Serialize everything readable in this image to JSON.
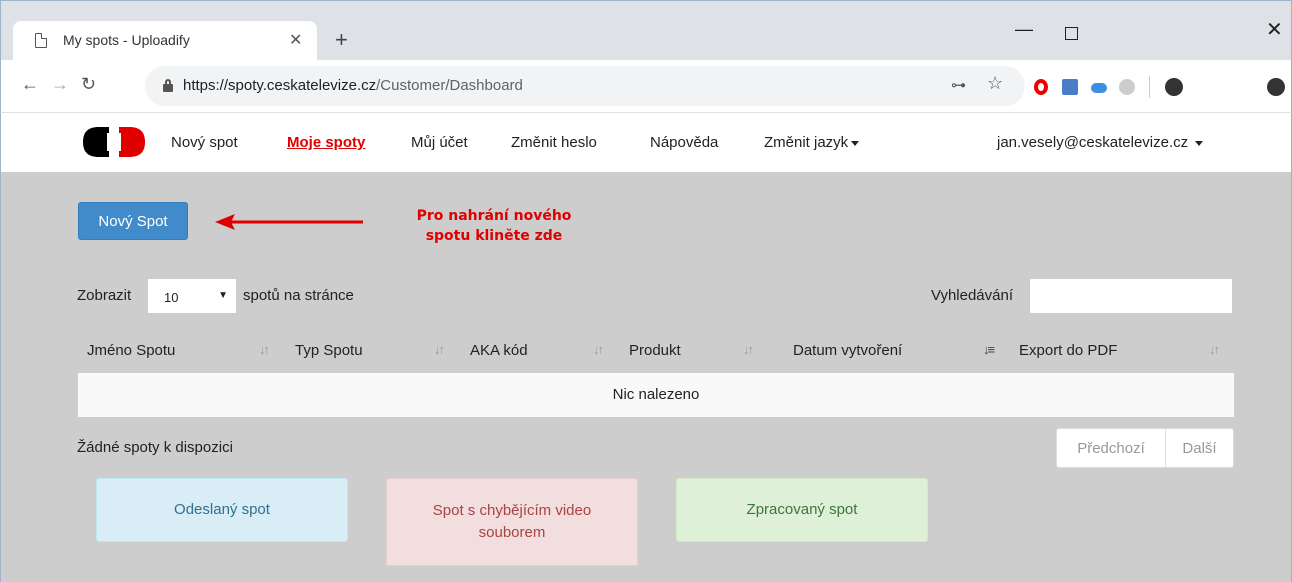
{
  "browser": {
    "tab_title": "My spots - Uploadify",
    "url_host": "https://spoty.ceskatelevize.cz",
    "url_path": "/Customer/Dashboard"
  },
  "nav": {
    "items": [
      "Nový spot",
      "Moje spoty",
      "Můj účet",
      "Změnit heslo",
      "Nápověda",
      "Změnit jazyk"
    ],
    "active": "Moje spoty",
    "user": "jan.vesely@ceskatelevize.cz"
  },
  "main": {
    "new_button": "Nový Spot",
    "annotation_line1": "Pro nahrání nového",
    "annotation_line2": "spotu klinĕte zde",
    "show_label": "Zobrazit",
    "page_size": "10",
    "per_page_label": "spotů na stránce",
    "search_label": "Vyhledávání",
    "search_value": ""
  },
  "table": {
    "columns": [
      "Jméno Spotu",
      "Typ Spotu",
      "AKA kód",
      "Produkt",
      "Datum vytvoření",
      "Export do PDF"
    ],
    "empty_text": "Nic nalezeno",
    "info": "Žádné spoty k dispozici",
    "prev": "Předchozí",
    "next": "Další"
  },
  "legend": {
    "sent": "Odeslaný spot",
    "missing": "Spot s chybějícím video souborem",
    "done": "Zpracovaný spot"
  },
  "colors": {
    "brand_red": "#e00000",
    "primary_button": "#428bca",
    "content_bg": "#cdcdcd"
  }
}
